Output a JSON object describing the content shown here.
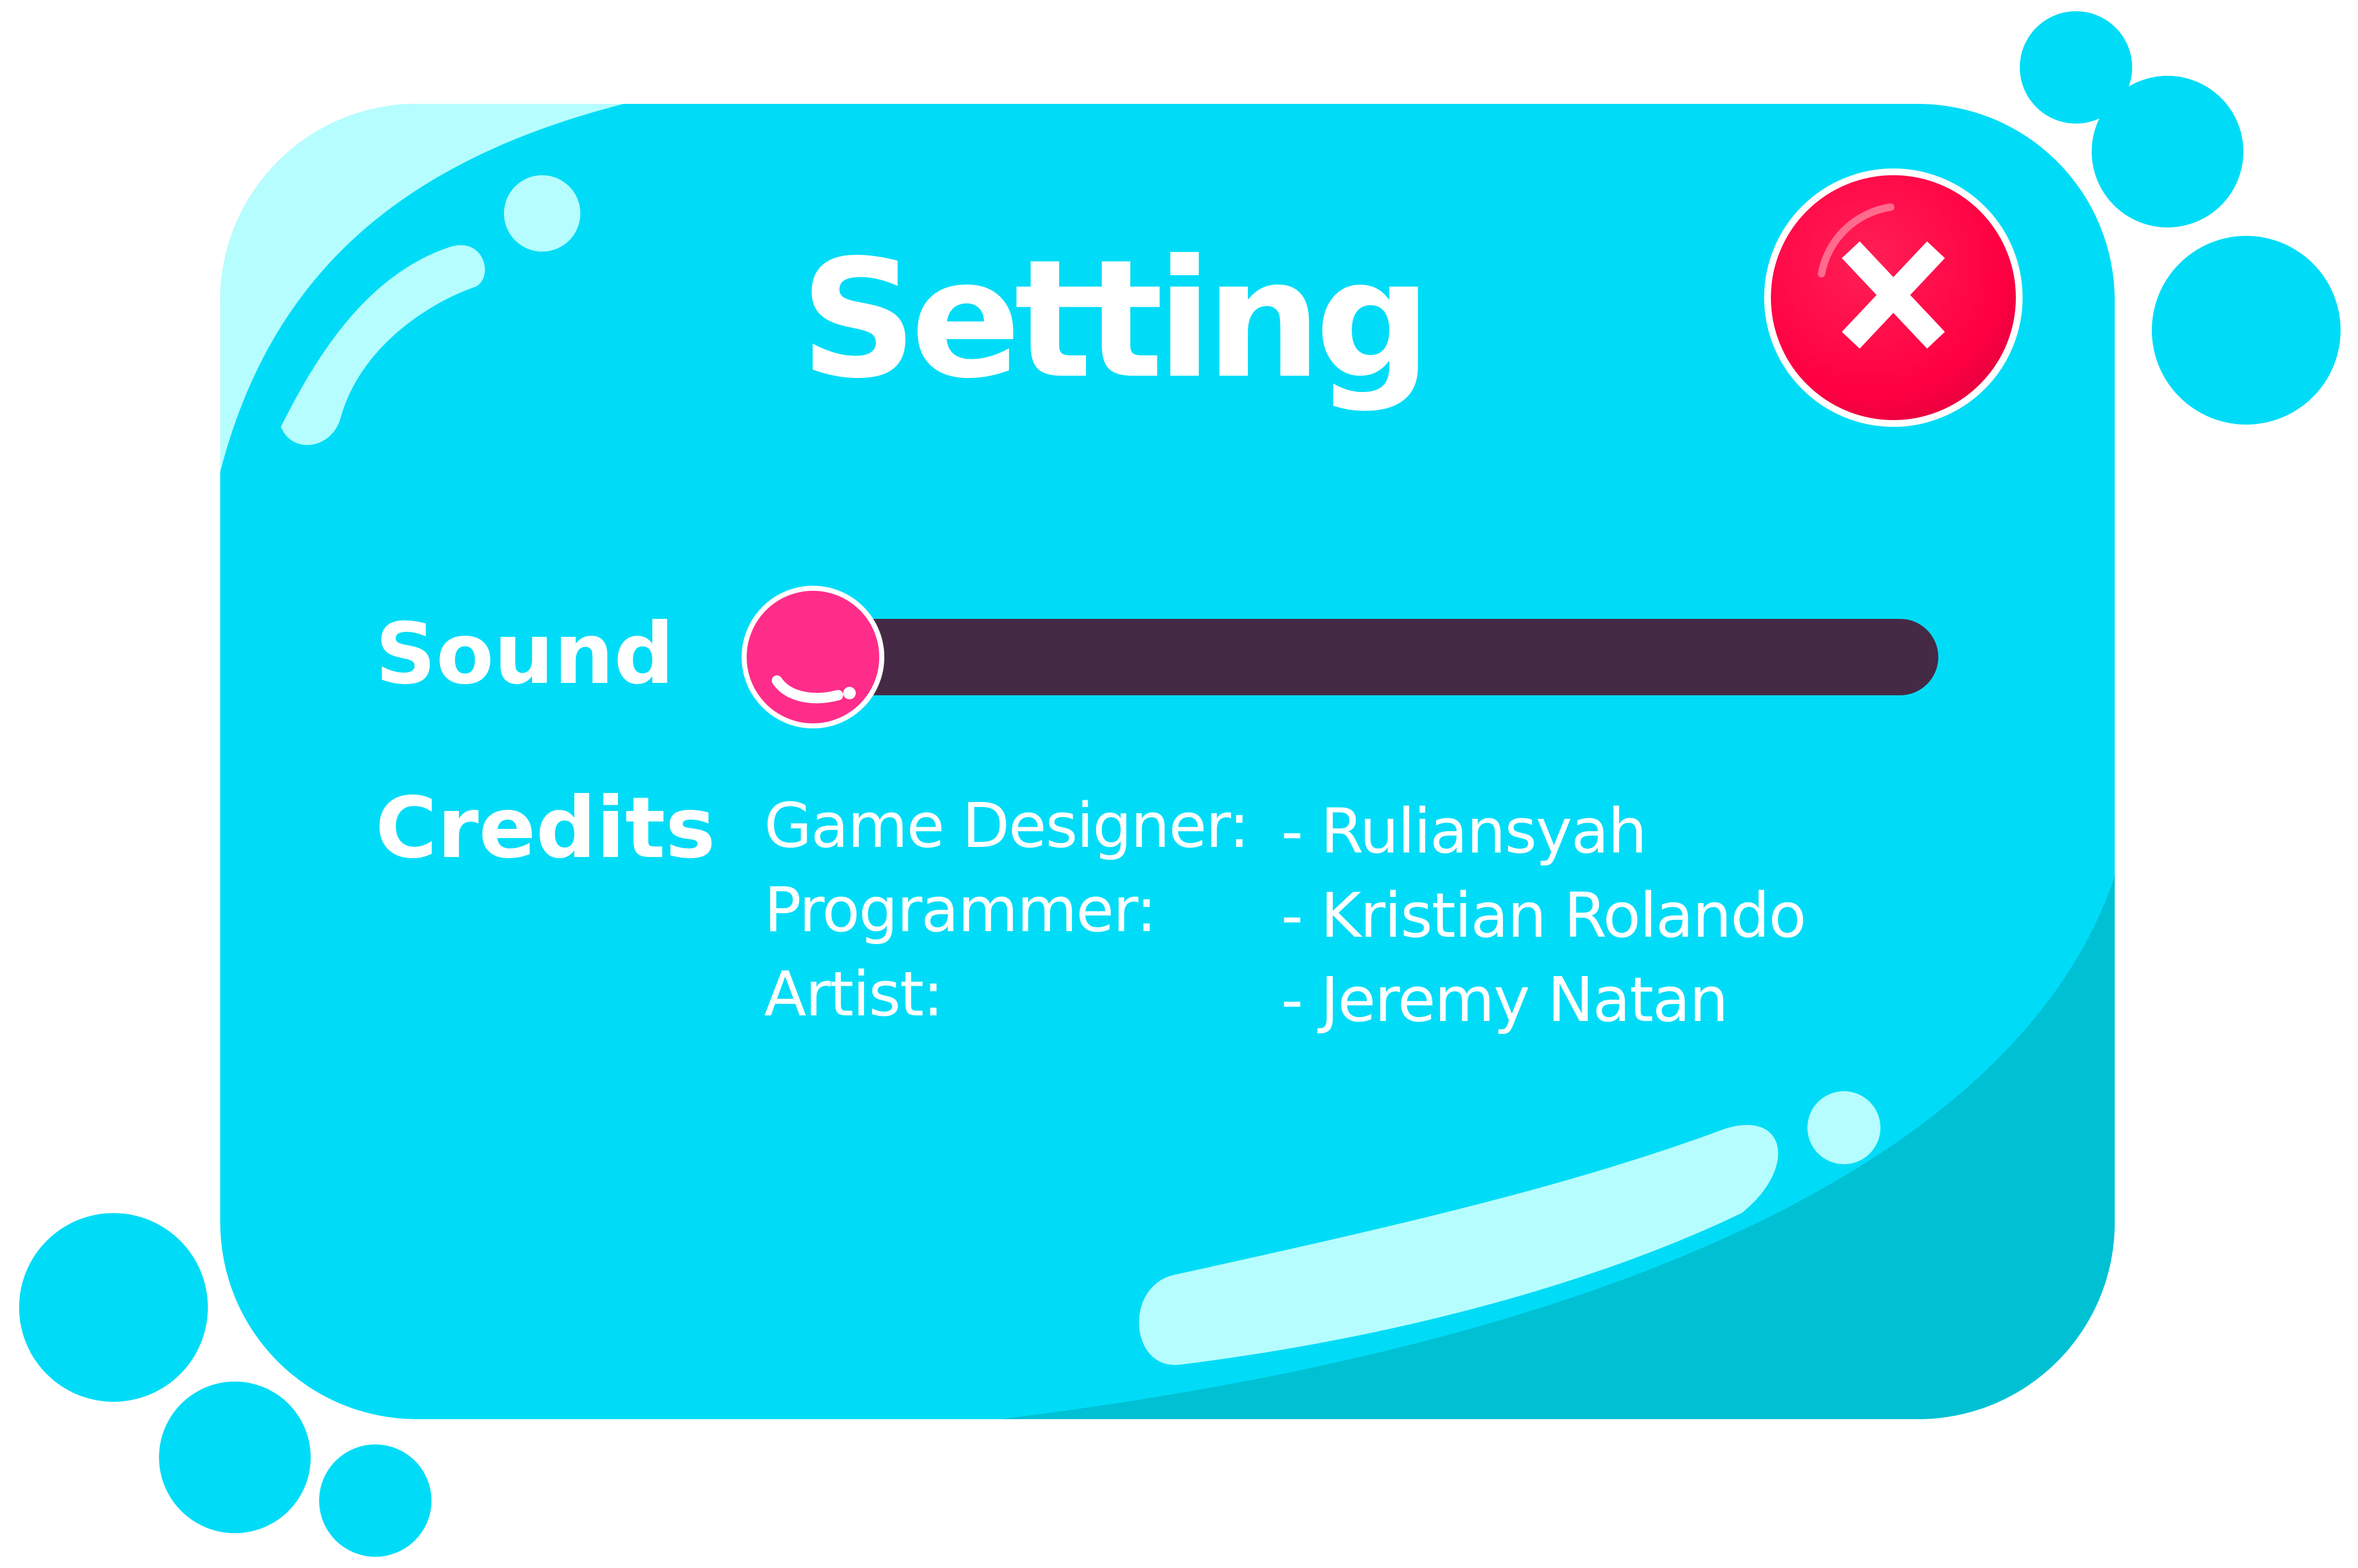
{
  "dialog": {
    "title": "Setting",
    "close_icon": "close-x-icon"
  },
  "sound": {
    "label": "Sound",
    "level": 0
  },
  "credits": {
    "label": "Credits",
    "entries": [
      {
        "role": "Game Designer:",
        "name": "- Ruliansyah"
      },
      {
        "role": "Programmer:",
        "name": "- Kristian Rolando"
      },
      {
        "role": "Artist:",
        "name": "- Jeremy Natan"
      }
    ]
  },
  "colors": {
    "panel": "#00dcf7",
    "panel_shade": "#00c0d4",
    "highlight": "#b6fdff",
    "close_button": "#ff0042",
    "slider_track": "#452a45",
    "slider_knob": "#ff2d8a",
    "text": "#ffffff"
  }
}
